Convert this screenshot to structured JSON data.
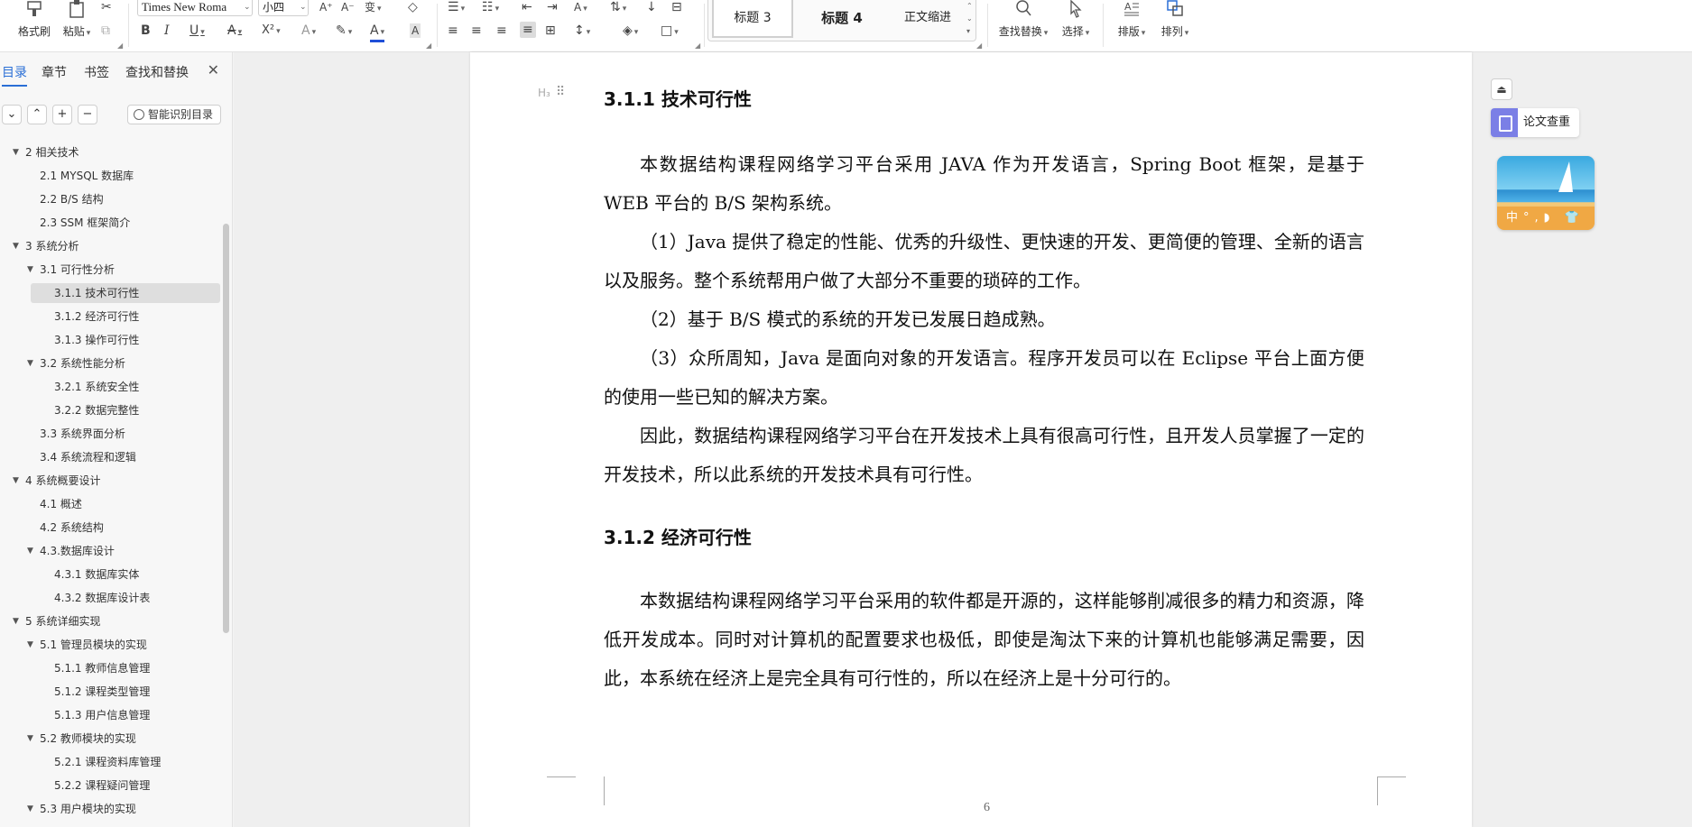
{
  "ribbon": {
    "format_painter": "格式刷",
    "paste": "粘贴",
    "font_name": "Times New Roma",
    "font_size": "小四",
    "styles": [
      {
        "label": "标题 3"
      },
      {
        "label": "标题 4"
      },
      {
        "label": "正文缩进"
      }
    ],
    "find_replace": "查找替换",
    "select": "选择",
    "layout": "排版",
    "arrange": "排列"
  },
  "nav": {
    "tabs": [
      "目录",
      "章节",
      "书签",
      "查找和替换"
    ],
    "smart_toc": "智能识别目录",
    "items": [
      {
        "text": "2 相关技术",
        "level": 1,
        "expanded": true
      },
      {
        "text": "2.1 MYSQL 数据库",
        "level": 2
      },
      {
        "text": "2.2 B/S 结构",
        "level": 2
      },
      {
        "text": "2.3 SSM 框架简介",
        "level": 2
      },
      {
        "text": "3 系统分析",
        "level": 1,
        "expanded": true
      },
      {
        "text": "3.1 可行性分析",
        "level": 2,
        "expanded": true
      },
      {
        "text": "3.1.1 技术可行性",
        "level": 3,
        "selected": true
      },
      {
        "text": "3.1.2 经济可行性",
        "level": 3
      },
      {
        "text": "3.1.3 操作可行性",
        "level": 3
      },
      {
        "text": "3.2 系统性能分析",
        "level": 2,
        "expanded": true
      },
      {
        "text": "3.2.1  系统安全性",
        "level": 3
      },
      {
        "text": "3.2.2  数据完整性",
        "level": 3
      },
      {
        "text": "3.3 系统界面分析",
        "level": 2
      },
      {
        "text": "3.4 系统流程和逻辑",
        "level": 2
      },
      {
        "text": "4 系统概要设计",
        "level": 1,
        "expanded": true
      },
      {
        "text": "4.1 概述",
        "level": 2
      },
      {
        "text": "4.2 系统结构",
        "level": 2
      },
      {
        "text": "4.3.数据库设计",
        "level": 2,
        "expanded": true
      },
      {
        "text": "4.3.1 数据库实体",
        "level": 3
      },
      {
        "text": "4.3.2 数据库设计表",
        "level": 3
      },
      {
        "text": "5 系统详细实现",
        "level": 1,
        "expanded": true
      },
      {
        "text": "5.1  管理员模块的实现",
        "level": 2,
        "expanded": true
      },
      {
        "text": "5.1.1  教师信息管理",
        "level": 3
      },
      {
        "text": "5.1.2  课程类型管理",
        "level": 3
      },
      {
        "text": "5.1.3  用户信息管理",
        "level": 3
      },
      {
        "text": "5.2  教师模块的实现",
        "level": 2,
        "expanded": true
      },
      {
        "text": "5.2.1  课程资料库管理",
        "level": 3
      },
      {
        "text": "5.2.2  课程疑问管理",
        "level": 3
      },
      {
        "text": "5.3  用户模块的实现",
        "level": 2,
        "expanded": true
      }
    ]
  },
  "document": {
    "heading1": "3.1.1 技术可行性",
    "paragraphs1": [
      "本数据结构课程网络学习平台采用 JAVA 作为开发语言，Spring Boot 框架，是基于 WEB 平台的 B/S 架构系统。",
      "（1）Java 提供了稳定的性能、优秀的升级性、更快速的开发、更简便的管理、全新的语言以及服务。整个系统帮用户做了大部分不重要的琐碎的工作。",
      "（2）基于 B/S 模式的系统的开发已发展日趋成熟。",
      "（3）众所周知，Java 是面向对象的开发语言。程序开发员可以在 Eclipse 平台上面方便的使用一些已知的解决方案。",
      "因此，数据结构课程网络学习平台在开发技术上具有很高可行性，且开发人员掌握了一定的开发技术，所以此系统的开发技术具有可行性。"
    ],
    "heading2": "3.1.2 经济可行性",
    "paragraphs2": [
      "本数据结构课程网络学习平台采用的软件都是开源的，这样能够削减很多的精力和资源，降低开发成本。同时对计算机的配置要求也极低，即使是淘汰下来的计算机也能够满足需要，因此，本系统在经济上是完全具有可行性的，所以在经济上是十分可行的。"
    ],
    "page_number": "6"
  },
  "right_panel": {
    "paper_check": "论文查重",
    "ime_bar": "中°,◗ 👕"
  }
}
